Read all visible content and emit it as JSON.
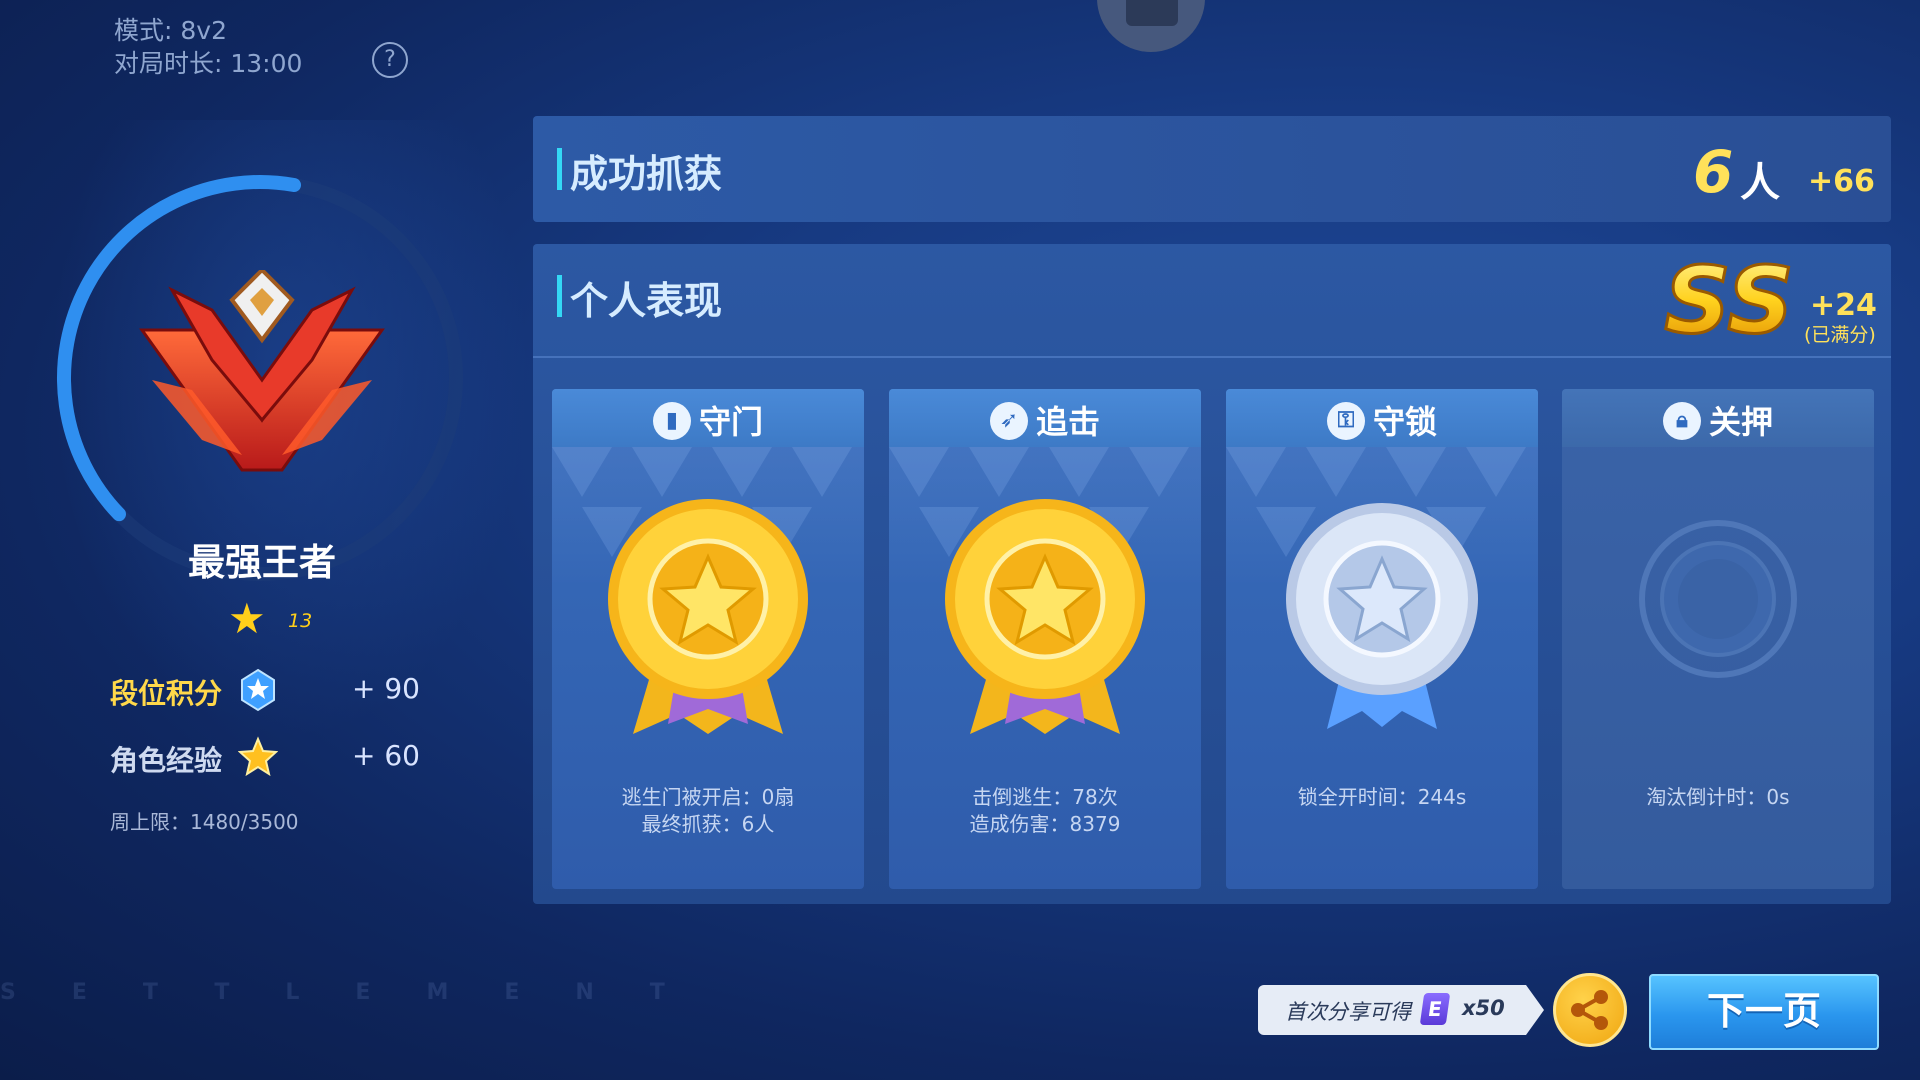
{
  "header": {
    "mode_label": "模式: 8v2",
    "duration_label": "对局时长: 13:00",
    "help_icon": "?"
  },
  "rank": {
    "name": "最强王者",
    "star_count": "13",
    "score_label": "段位积分",
    "score_value": "+ 90",
    "exp_label": "角色经验",
    "exp_value": "+ 60",
    "weekly_limit": "周上限：1480/3500",
    "ring_progress": 0.4
  },
  "catch": {
    "title": "成功抓获",
    "count": "6",
    "unit": "人",
    "bonus": "+66"
  },
  "performance": {
    "title": "个人表现",
    "grade": "SS",
    "bonus": "+24",
    "note": "(已满分)",
    "cards": [
      {
        "title": "守门",
        "icon": "door-icon",
        "medal": "gold",
        "line1": "逃生门被开启：0扇",
        "line2": "最终抓获：6人"
      },
      {
        "title": "追击",
        "icon": "chase-icon",
        "medal": "gold",
        "line1": "击倒逃生：78次",
        "line2": "造成伤害：8379"
      },
      {
        "title": "守锁",
        "icon": "wrench-icon",
        "medal": "silver",
        "line1": "锁全开时间：244s",
        "line2": ""
      },
      {
        "title": "关押",
        "icon": "lock-icon",
        "medal": "none",
        "line1": "淘汰倒计时：0s",
        "line2": ""
      }
    ]
  },
  "footer": {
    "settlement_watermark": "SETTLEMENT",
    "share_text": "首次分享可得",
    "share_currency": "E",
    "share_qty": "x50",
    "next_label": "下一页"
  },
  "colors": {
    "accent_gold": "#ffe15a",
    "accent_cyan": "#34d8f5",
    "button_blue": "#2a96ee"
  }
}
